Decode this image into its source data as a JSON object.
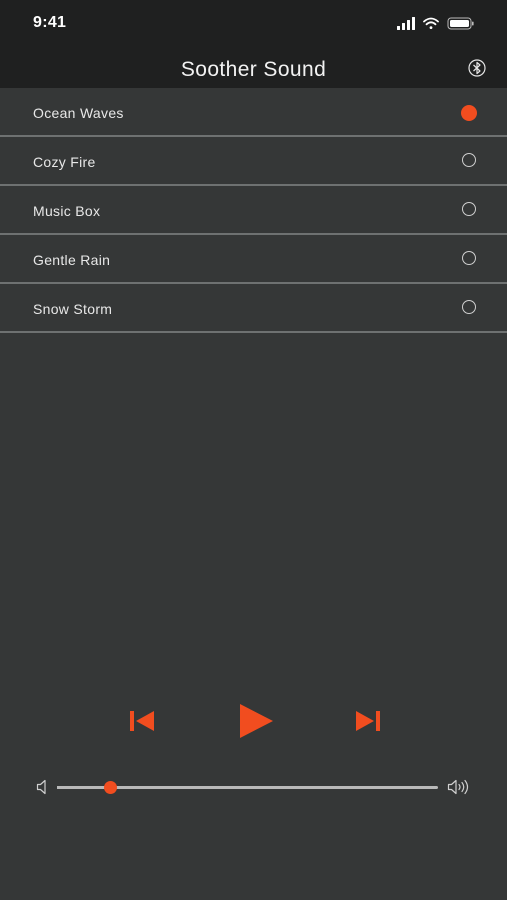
{
  "status_bar": {
    "time": "9:41",
    "icons": [
      "signal-icon",
      "wifi-icon",
      "battery-icon"
    ]
  },
  "nav": {
    "title": "Soother Sound",
    "bluetooth_icon": "bluetooth-icon"
  },
  "sounds": [
    {
      "label": "Ocean Waves",
      "selected": true
    },
    {
      "label": "Cozy Fire",
      "selected": false
    },
    {
      "label": "Music Box",
      "selected": false
    },
    {
      "label": "Gentle Rain",
      "selected": false
    },
    {
      "label": "Snow Storm",
      "selected": false
    }
  ],
  "player": {
    "prev_icon": "skip-previous-icon",
    "play_icon": "play-icon",
    "next_icon": "skip-next-icon"
  },
  "volume": {
    "level": 0.14,
    "low_icon": "volume-low-icon",
    "high_icon": "volume-high-icon"
  },
  "colors": {
    "accent": "#f14d1f",
    "background": "#353737",
    "header": "#1f2020",
    "divider": "#6e7171"
  }
}
